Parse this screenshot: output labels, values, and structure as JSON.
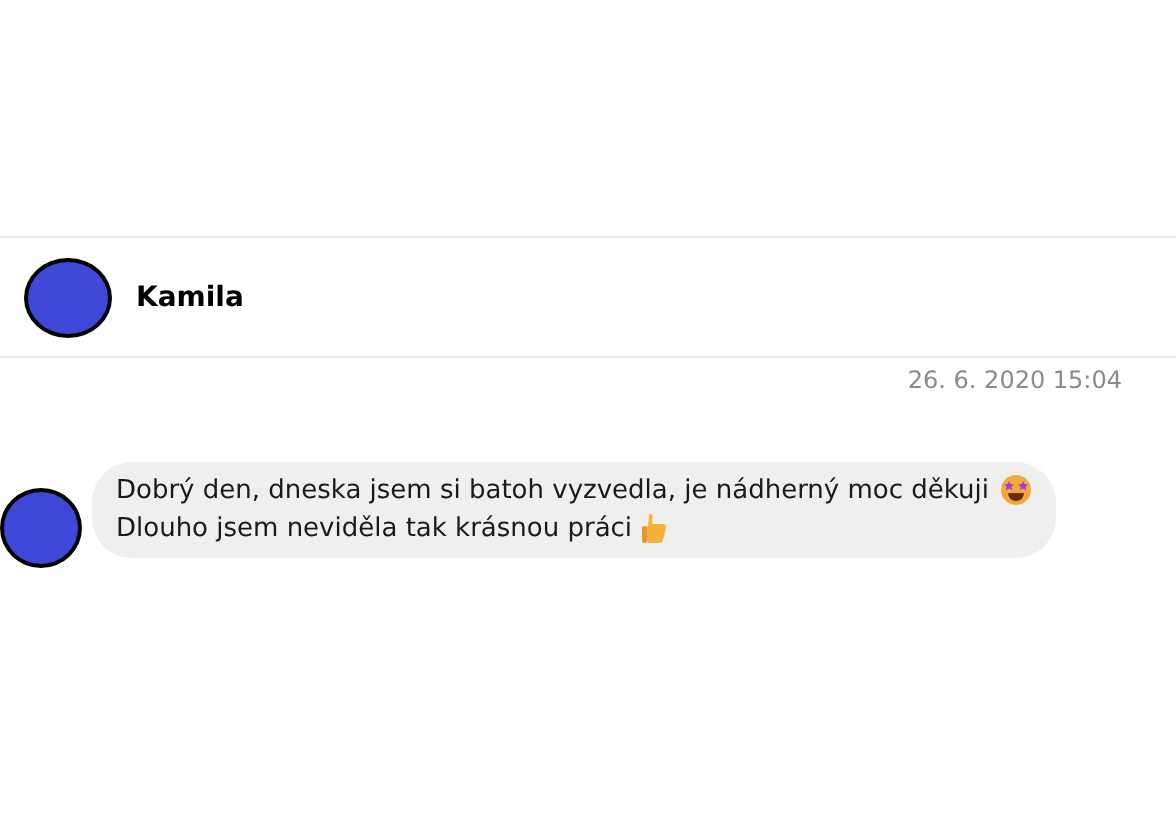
{
  "contact": {
    "name": "Kamila"
  },
  "timestamp": "26. 6. 2020 15:04",
  "message": {
    "lines": [
      {
        "text": "Dobrý den, dneska jsem si batoh vyzvedla, je nádherný moc děkuji",
        "kind": "star-eyes"
      },
      {
        "text": "Dlouho jsem neviděla tak krásnou práci",
        "kind": "thumbs-up"
      }
    ]
  }
}
